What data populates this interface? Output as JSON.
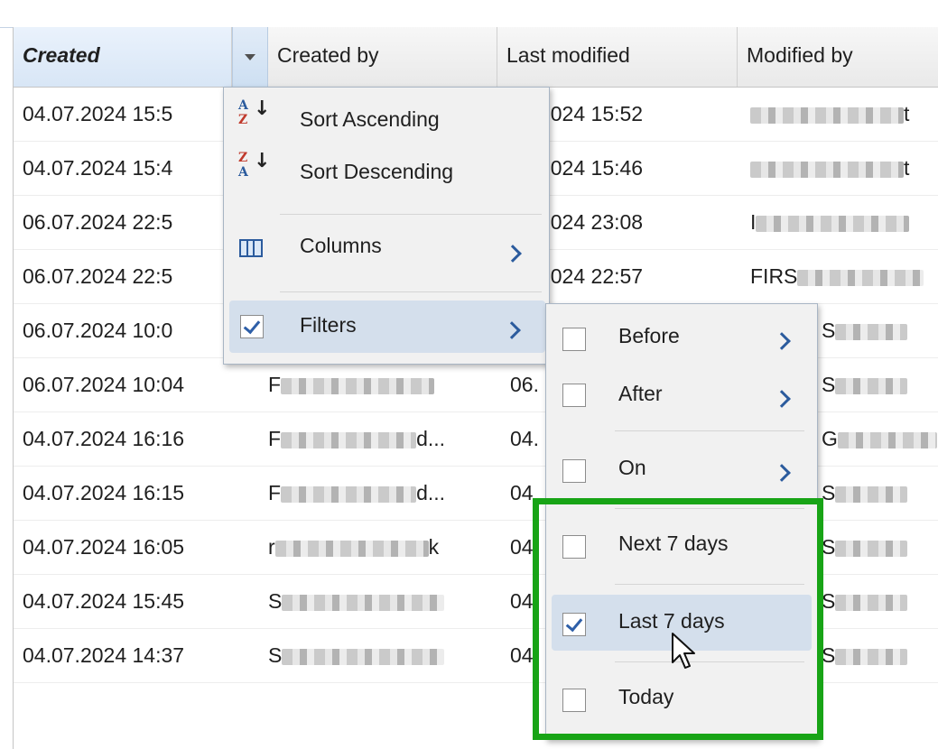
{
  "grid": {
    "columns": [
      "Created",
      "Created by",
      "Last modified",
      "Modified by"
    ],
    "rows": [
      {
        "created": "04.07.2024 15:5",
        "created_by": "",
        "last_modified": "07.2024 15:52",
        "modified_by_prefix": "",
        "modified_by_suffix": "t"
      },
      {
        "created": "04.07.2024 15:4",
        "created_by": "",
        "last_modified": "07.2024 15:46",
        "modified_by_prefix": "",
        "modified_by_suffix": "t"
      },
      {
        "created": "06.07.2024 22:5",
        "created_by": "",
        "last_modified": "07.2024 23:08",
        "modified_by_prefix": "I",
        "modified_by_suffix": ""
      },
      {
        "created": "06.07.2024 22:5",
        "created_by": "",
        "last_modified": "07.2024 22:57",
        "modified_by_prefix": "FIRS",
        "modified_by_suffix": ""
      },
      {
        "created": "06.07.2024 10:0",
        "created_by": "",
        "last_modified": "",
        "modified_by_prefix": "S",
        "modified_by_suffix": ""
      },
      {
        "created": "06.07.2024 10:04",
        "created_by": "F",
        "last_modified": "06.",
        "modified_by_prefix": "S",
        "modified_by_suffix": ""
      },
      {
        "created": "04.07.2024 16:16",
        "created_by": "F",
        "created_by_suffix": "d...",
        "last_modified": "04.",
        "modified_by_prefix": "G",
        "modified_by_suffix": ""
      },
      {
        "created": "04.07.2024 16:15",
        "created_by": "F",
        "created_by_suffix": "d...",
        "last_modified": "04",
        "modified_by_prefix": "S",
        "modified_by_suffix": ""
      },
      {
        "created": "04.07.2024 16:05",
        "created_by": "r",
        "created_by_suffix": "k",
        "last_modified": "04",
        "modified_by_prefix": "S",
        "modified_by_suffix": ""
      },
      {
        "created": "04.07.2024 15:45",
        "created_by": "S",
        "last_modified": "04",
        "modified_by_prefix": "S",
        "modified_by_suffix": ""
      },
      {
        "created": "04.07.2024 14:37",
        "created_by": "S",
        "last_modified": "04",
        "modified_by_prefix": "S",
        "modified_by_suffix": ""
      }
    ]
  },
  "column_menu": {
    "sort_ascending": "Sort Ascending",
    "sort_descending": "Sort Descending",
    "columns": "Columns",
    "filters": "Filters",
    "filters_checked": true,
    "sort_asc_icon_top": "A",
    "sort_asc_icon_bottom": "Z",
    "sort_desc_icon_top": "Z",
    "sort_desc_icon_bottom": "A"
  },
  "filter_submenu": {
    "items": [
      {
        "label": "Before",
        "checked": false,
        "has_submenu": true
      },
      {
        "label": "After",
        "checked": false,
        "has_submenu": true
      },
      {
        "label": "On",
        "checked": false,
        "has_submenu": true
      },
      {
        "label": "Next 7 days",
        "checked": false,
        "has_submenu": false
      },
      {
        "label": "Last 7 days",
        "checked": true,
        "has_submenu": false
      },
      {
        "label": "Today",
        "checked": false,
        "has_submenu": false
      }
    ]
  },
  "colors": {
    "highlight_box": "#18a416",
    "accent_blue": "#2b5b9d",
    "menu_background": "#f1f1f1",
    "hover_background": "#d4dfec"
  },
  "icons": {
    "sort_asc": "sort-ascending-icon",
    "sort_desc": "sort-descending-icon",
    "columns": "columns-icon",
    "cursor": "mouse-pointer-icon"
  }
}
